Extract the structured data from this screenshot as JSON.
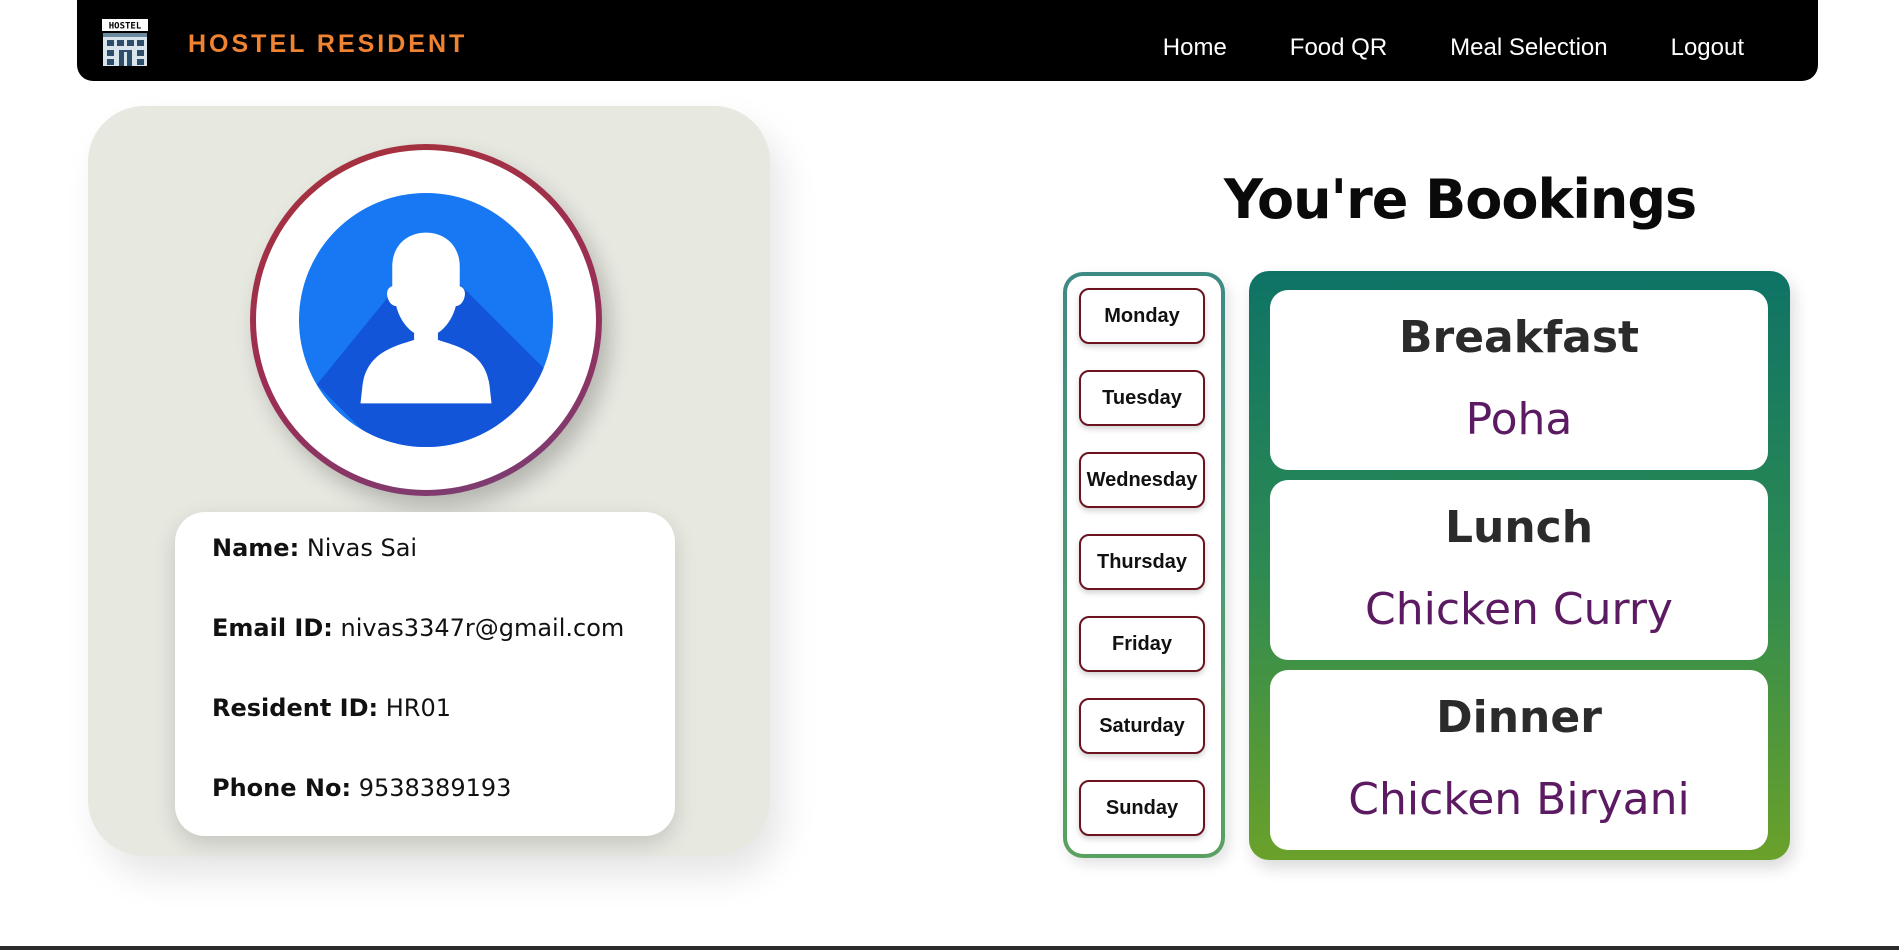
{
  "navbar": {
    "brand": "HOSTEL RESIDENT",
    "logo_text": "HOSTEL",
    "links": [
      "Home",
      "Food QR",
      "Meal Selection",
      "Logout"
    ]
  },
  "profile": {
    "avatar_icon": "user-avatar-icon",
    "fields": [
      {
        "label": "Name:",
        "value": "Nivas Sai"
      },
      {
        "label": "Email ID:",
        "value": "nivas3347r@gmail.com"
      },
      {
        "label": "Resident ID:",
        "value": "HR01"
      },
      {
        "label": "Phone No:",
        "value": "9538389193"
      }
    ]
  },
  "bookings": {
    "title": "You're Bookings",
    "days": [
      "Monday",
      "Tuesday",
      "Wednesday",
      "Thursday",
      "Friday",
      "Saturday",
      "Sunday"
    ],
    "meals": [
      {
        "name": "Breakfast",
        "item": "Poha"
      },
      {
        "name": "Lunch",
        "item": "Chicken Curry"
      },
      {
        "name": "Dinner",
        "item": "Chicken Biryani"
      }
    ]
  },
  "colors": {
    "brand": "#ef8332",
    "meal_item": "#5b1a62",
    "avatar_blue": "#1877f2"
  }
}
